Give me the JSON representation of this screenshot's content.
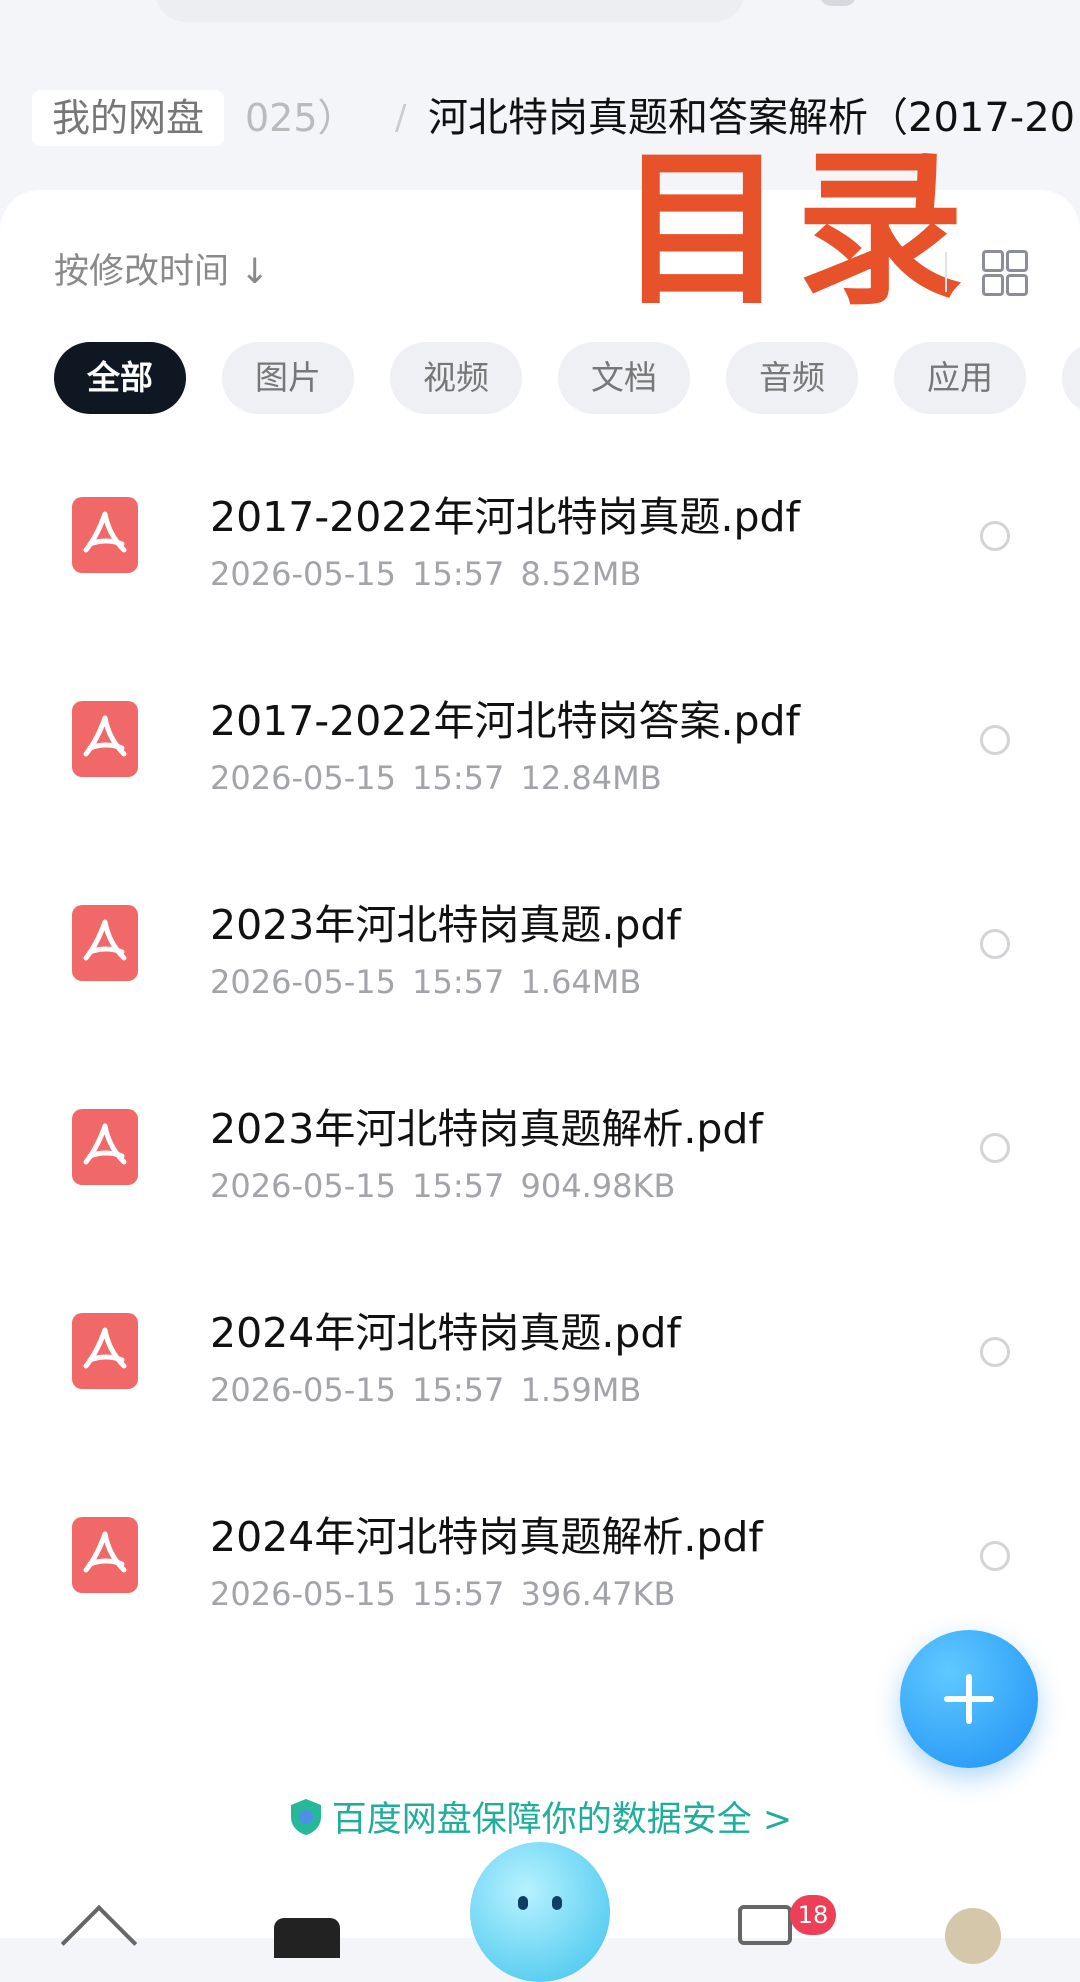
{
  "breadcrumb": {
    "root": "我的网盘",
    "prev_fragment": "025）",
    "separator": "/",
    "current": "河北特岗真题和答案解析（2017-20"
  },
  "overlay_title": "目录",
  "sort_label": "按修改时间 ↓",
  "tabs": [
    {
      "label": "全部",
      "active": true
    },
    {
      "label": "图片"
    },
    {
      "label": "视频"
    },
    {
      "label": "文档"
    },
    {
      "label": "音频"
    },
    {
      "label": "应用"
    }
  ],
  "files": [
    {
      "name": "2017-2022年河北特岗真题.pdf",
      "date": "2026-05-15",
      "time": "15:57",
      "size": "8.52MB"
    },
    {
      "name": "2017-2022年河北特岗答案.pdf",
      "date": "2026-05-15",
      "time": "15:57",
      "size": "12.84MB"
    },
    {
      "name": "2023年河北特岗真题.pdf",
      "date": "2026-05-15",
      "time": "15:57",
      "size": "1.64MB"
    },
    {
      "name": "2023年河北特岗真题解析.pdf",
      "date": "2026-05-15",
      "time": "15:57",
      "size": "904.98KB"
    },
    {
      "name": "2024年河北特岗真题.pdf",
      "date": "2026-05-15",
      "time": "15:57",
      "size": "1.59MB"
    },
    {
      "name": "2024年河北特岗真题解析.pdf",
      "date": "2026-05-15",
      "time": "15:57",
      "size": "396.47KB"
    }
  ],
  "safety_banner": "百度网盘保障你的数据安全",
  "safety_arrow": ">",
  "messages_badge": "18",
  "colors": {
    "accent": "#1e90f5",
    "overlay": "#e8522b",
    "pdf": "#f06868",
    "safety": "#1fae9a"
  }
}
